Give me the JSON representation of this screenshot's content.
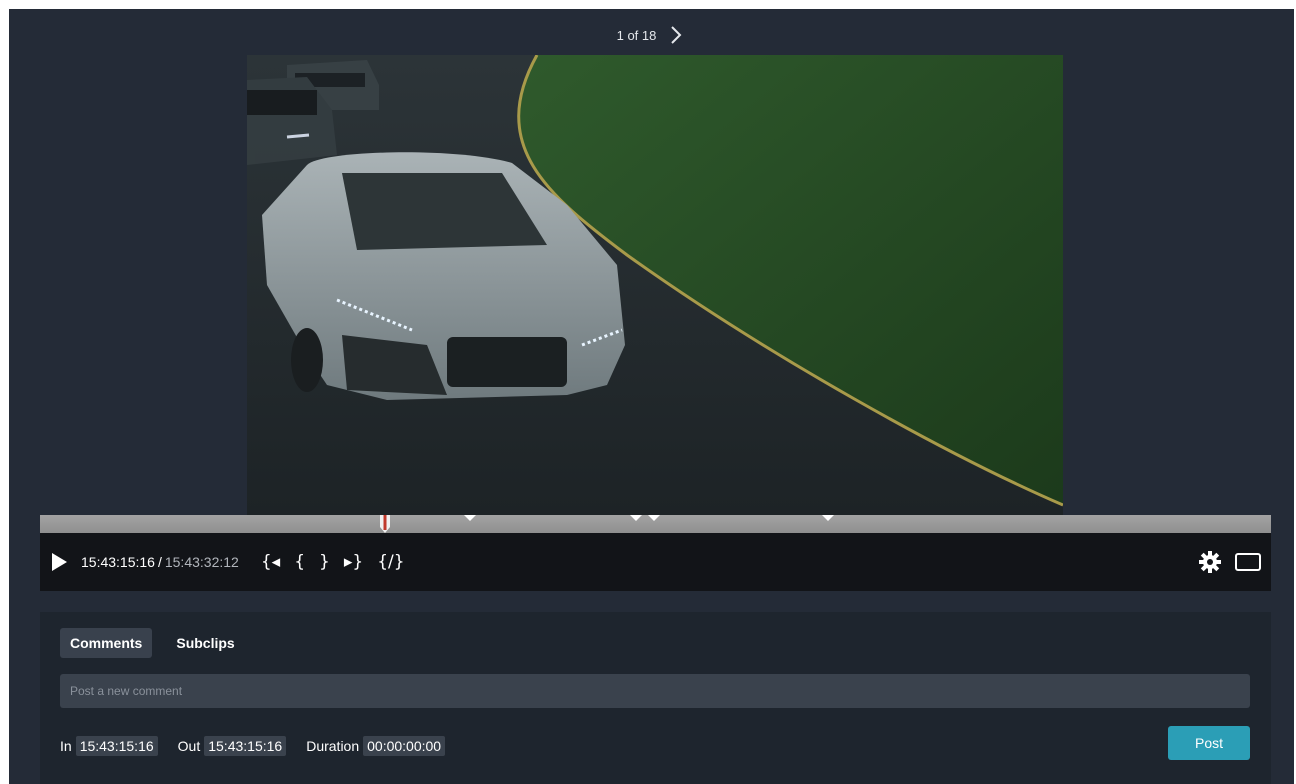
{
  "pager": {
    "label": "1 of 18"
  },
  "player": {
    "current_timecode": "15:43:15:16",
    "separator": "/",
    "duration_timecode": "15:43:32:12",
    "mark_controls": [
      "{◂",
      "{",
      "}",
      "▸}",
      "{/}"
    ],
    "playhead_position": 0.28,
    "markers": [
      0.349,
      0.484,
      0.499,
      0.64
    ]
  },
  "tabs": [
    "Comments",
    "Subclips"
  ],
  "comment": {
    "placeholder": "Post a new comment"
  },
  "times": {
    "in_label": "In",
    "in_value": "15:43:15:16",
    "out_label": "Out",
    "out_value": "15:43:15:16",
    "duration_label": "Duration",
    "duration_value": "00:00:00:00"
  },
  "post_button": "Post",
  "icons": {
    "next": "chevron-right-icon",
    "play": "play-icon",
    "settings": "gear-icon",
    "theater": "theater-mode-icon"
  },
  "colors": {
    "background": "#242b37",
    "accent": "#2b9eb6",
    "playhead": "#c0392b"
  }
}
